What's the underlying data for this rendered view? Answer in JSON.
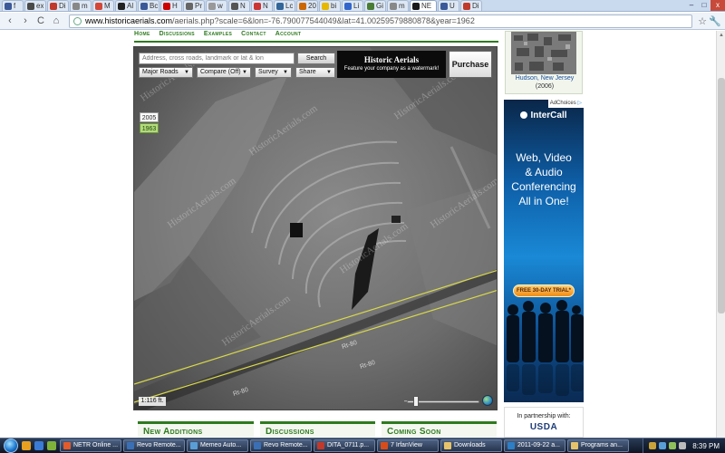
{
  "browser": {
    "tabs": [
      {
        "title": "f",
        "color": "#3b5998"
      },
      {
        "title": "ex",
        "color": "#4a4a4a"
      },
      {
        "title": "Di",
        "color": "#c0392b"
      },
      {
        "title": "m",
        "color": "#888888"
      },
      {
        "title": "M",
        "color": "#d44638"
      },
      {
        "title": "Al",
        "color": "#222222"
      },
      {
        "title": "Bc",
        "color": "#3b5998"
      },
      {
        "title": "H",
        "color": "#cc0000"
      },
      {
        "title": "Pr",
        "color": "#666666"
      },
      {
        "title": "w",
        "color": "#999999"
      },
      {
        "title": "N",
        "color": "#555555"
      },
      {
        "title": "N",
        "color": "#cc3333"
      },
      {
        "title": "Lc",
        "color": "#336699"
      },
      {
        "title": "20",
        "color": "#cc6600"
      },
      {
        "title": "bi",
        "color": "#e6b800"
      },
      {
        "title": "Li",
        "color": "#3366cc"
      },
      {
        "title": "Gi",
        "color": "#4a7c34"
      },
      {
        "title": "m",
        "color": "#888888"
      },
      {
        "title": "NE",
        "color": "#1a1a1a",
        "active": true
      },
      {
        "title": "U",
        "color": "#3b5998"
      },
      {
        "title": "Di",
        "color": "#c0392b"
      }
    ],
    "window_buttons": [
      "–",
      "□",
      "x"
    ],
    "nav": {
      "back": "‹",
      "forward": "›",
      "reload": "C",
      "home": "⌂"
    },
    "url_host": "www.historicaerials.com",
    "url_rest": "/aerials.php?scale=6&lon=-76.790077544049&lat=41.00259579880878&year=1962",
    "star": "☆",
    "wrench": "🔧"
  },
  "site_nav": [
    "Home",
    "Discussions",
    "Examples",
    "Contact",
    "Account"
  ],
  "map": {
    "search_placeholder": "Address, cross roads, landmark or lat & lon",
    "search_button": "Search",
    "dropdowns": [
      "Major Roads",
      "Compare (Off)",
      "Survey",
      "Share"
    ],
    "banner_title": "Historic Aerials",
    "banner_sub": "Feature your company as a watermark!",
    "purchase": "Purchase",
    "years": [
      "2005",
      "1963"
    ],
    "selected_year": "1963",
    "scale_label": "1:116 ft.",
    "zoom_minus": "–",
    "zoom_level": 0.1,
    "road_labels": [
      "Rt-80",
      "Rt-80",
      "Rt-80"
    ],
    "watermark_text": "HistoricAerials.com"
  },
  "sections": [
    "New Additions",
    "Discussions",
    "Coming Soon"
  ],
  "thumbnail": {
    "place": "Hudson, New Jersey",
    "year": "(2006)"
  },
  "ad": {
    "adchoices": "AdChoices",
    "brand": "InterCall",
    "lines": [
      "Web, Video",
      "& Audio",
      "Conferencing",
      "All in One!"
    ],
    "cta": "FREE 30-DAY TRIAL*"
  },
  "partner": {
    "label": "In partnership with:",
    "logo": "USDA"
  },
  "taskbar": {
    "quick_launch_colors": [
      "#e8a020",
      "#3a7bd5",
      "#7fb23a"
    ],
    "tasks": [
      {
        "label": "NETR Online ...",
        "color": "#e35b2a"
      },
      {
        "label": "Revo Remote...",
        "color": "#3a6fb5"
      },
      {
        "label": "Memeo Auto...",
        "color": "#5a9ed6"
      },
      {
        "label": "Revo Remote...",
        "color": "#3a6fb5"
      },
      {
        "label": "DITA_0711.p...",
        "color": "#c0392b"
      },
      {
        "label": "7 IrfanView",
        "color": "#d94c1a"
      },
      {
        "label": "Downloads",
        "color": "#e6c36a"
      },
      {
        "label": "2011-09-22 a...",
        "color": "#2d7ec4"
      },
      {
        "label": "Programs an...",
        "color": "#e6c36a"
      }
    ],
    "clock": "8:39 PM"
  }
}
